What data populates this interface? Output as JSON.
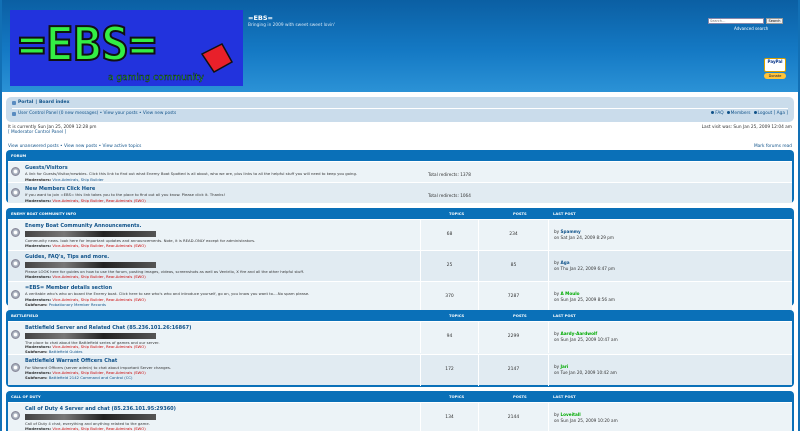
{
  "header": {
    "site_title": "=EBS=",
    "site_desc": "Bringing in 2009 with sweet sweet lovin'",
    "logo_text": "=EBS=",
    "logo_tagline": "a gaming community",
    "search_placeholder": "Search…",
    "search_button": "Search",
    "advanced_search": "Advanced search",
    "donate_top": "PayPal",
    "donate_label": "Donate"
  },
  "navbar": {
    "crumb_portal": "Portal",
    "crumb_sep": "|",
    "crumb_index": "Board index",
    "ucp": "User Control Panel (0 new messages) • View your posts • View new posts",
    "faq": "FAQ",
    "members": "Members",
    "logout": "Logout [ Aga ]"
  },
  "info": {
    "current_time": "It is currently Sun Jan 25, 2009 12:28 pm",
    "mod_cp": "[ Moderator Control Panel ]",
    "last_visit": "Last visit was: Sun Jan 25, 2009 12:04 am",
    "unanswered": "View unanswered posts • View new posts • View active topics",
    "mark_read": "Mark forums read"
  },
  "colors": {
    "header": "#1270b5",
    "category": "#0a70b8",
    "link": "#105289",
    "row": "#ecf3f7"
  },
  "categories": [
    {
      "name": "FORUM",
      "topics": "",
      "posts": "",
      "last": "",
      "forums": [
        {
          "title": "Guests/Visitors",
          "desc": "A link for Guests/Visitor/newbies. Click this link to find out what Enemy Boat Spotted is all about, who we are, plus links to all the helpful stuff you will need to keep you going.",
          "mods_label": "Moderators:",
          "mods": "Vice-Admirals, Ship Builder",
          "redirects": "Total redirects: 1378"
        },
        {
          "title": "New Members Click Here",
          "desc": "If you want to join =EBS= this link takes you to the place to find out all you know. Please click it. Thanks!",
          "mods_label": "Moderators:",
          "mods": "Vice-Admirals, Ship Builder, Rear-Admirals (SWO)",
          "redirects": "Total redirects: 1064"
        }
      ]
    },
    {
      "name": "ENEMY BOAT COMMUNITY INFO",
      "topics": "TOPICS",
      "posts": "POSTS",
      "last": "LAST POST",
      "forums": [
        {
          "title": "Enemy Boat Community Announcements.",
          "desc": "Community news. look here for important updates and announcements. Note, it is READ-ONLY except for administrators.",
          "mods_label": "Moderators:",
          "mods": "Vice-Admirals, Ship Builder, Rear-Admirals (SWO)",
          "topics": "68",
          "posts": "234",
          "by": "by",
          "last_user": "Spammy",
          "last_date": "on Sat Jan 24, 2009 8:29 pm"
        },
        {
          "title": "Guides, FAQ's, Tips and more.",
          "desc": "Please LOOK here for guides on how to use the forum, posting images, videos, screenshots as well as Ventrilo, X fire and all the other helpful stuff.",
          "mods_label": "Moderators:",
          "mods": "Vice-Admirals, Ship Builder, Rear-Admirals (SWO)",
          "topics": "25",
          "posts": "85",
          "by": "by",
          "last_user": "Aga",
          "last_date": "on Thu Jan 22, 2009 6:47 pm"
        },
        {
          "title": "=EBS= Member details section",
          "desc": "A veritable who's who on board the Enemy boat. Click here to see who's who and introduce yourself, go on, you know you want to....No spam please.",
          "mods_label": "Moderators:",
          "mods": "Vice-Admirals, Ship Builder, Rear-Admirals (SWO)",
          "sub_label": "Subforum:",
          "sub": "Probationary Member Records",
          "topics": "370",
          "posts": "7287",
          "by": "by",
          "last_user": "A Moulo",
          "last_date": "on Sun Jan 25, 2009 8:56 am"
        }
      ]
    },
    {
      "name": "BATTLEFIELD",
      "topics": "TOPICS",
      "posts": "POSTS",
      "last": "LAST POST",
      "forums": [
        {
          "title": "Battlefield Server and Related Chat (85.236.101.26:16867)",
          "desc": "The place to chat about the Battlefield series of games and our server.",
          "mods_label": "Moderators:",
          "mods": "Vice-Admirals, Ship Builder, Rear-Admirals (SWO)",
          "sub_label": "Subforum:",
          "sub": "Battlefield Guides",
          "topics": "94",
          "posts": "2299",
          "by": "by",
          "last_user": "Aardy-Aardwolf",
          "last_date": "on Sun Jan 25, 2009 10:47 am"
        },
        {
          "title": "Battlefield Warrant Officers Chat",
          "desc": "For Warrant Officers (server admin) to chat about important Server changes.",
          "mods_label": "Moderators:",
          "mods": "Vice-Admirals, Ship Builder, Rear-Admirals (SWO)",
          "sub_label": "Subforum:",
          "sub": "Battlefield 2142 Command and Control (CC)",
          "topics": "172",
          "posts": "2147",
          "by": "by",
          "last_user": "Jari",
          "last_date": "on Tue Jan 20, 2009 10:42 am"
        }
      ]
    },
    {
      "name": "CALL OF DUTY",
      "topics": "TOPICS",
      "posts": "POSTS",
      "last": "LAST POST",
      "forums": [
        {
          "title": "Call of Duty 4 Server and chat (85.236.101.95:29360)",
          "desc": "Call of Duty 4 chat, everything and anything related to the game.",
          "mods_label": "Moderators:",
          "mods": "Vice-Admirals, Ship Builder, Rear-Admirals (SWO)",
          "topics": "134",
          "posts": "2144",
          "by": "by",
          "last_user": "Loveitall",
          "last_date": "on Sun Jan 25, 2009 10:20 am"
        }
      ]
    }
  ]
}
